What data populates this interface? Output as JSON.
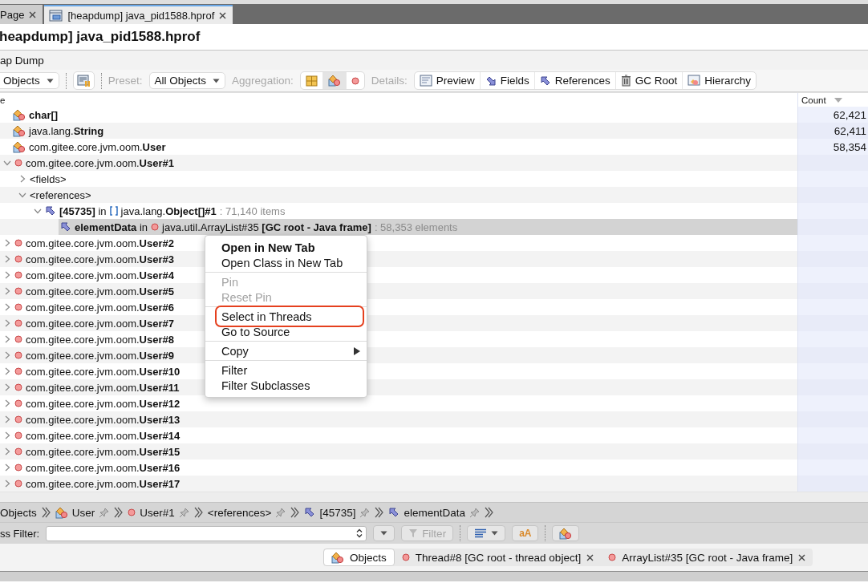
{
  "tabs": [
    {
      "label": "Page",
      "selected": false
    },
    {
      "label": "[heapdump] java_pid1588.hprof",
      "selected": true
    }
  ],
  "title": "heapdump] java_pid1588.hprof",
  "view_title": "ap Dump",
  "toolbar": {
    "view_dropdown": "Objects",
    "preset_label": "Preset:",
    "preset": "All Objects",
    "aggregation_label": "Aggregation:",
    "aggregation": [
      {
        "selected": false
      },
      {
        "selected": true
      },
      {
        "selected": false
      }
    ],
    "details_label": "Details:",
    "details": [
      {
        "label": "Preview"
      },
      {
        "label": "Fields"
      },
      {
        "label": "References"
      },
      {
        "label": "GC Root"
      },
      {
        "label": "Hierarchy"
      }
    ]
  },
  "table": {
    "columns": [
      {
        "label": "e"
      },
      {
        "label": "Count"
      }
    ],
    "rows": [
      {
        "kind": "class",
        "label": "char[]",
        "bold": true,
        "count": "62,421",
        "selected": false
      },
      {
        "kind": "class",
        "label": "java.lang.**String**",
        "bold": false,
        "count": "62,411",
        "selected": false
      },
      {
        "kind": "class",
        "label": "com.gitee.core.jvm.oom.**User**",
        "bold": false,
        "count": "58,354",
        "selected": false,
        "children": [
          {
            "kind": "instance",
            "label": "com.gitee.core.jvm.oom.**User#1**",
            "expanded": true,
            "selected": false,
            "children": [
              {
                "kind": "folder",
                "label": "<fields>",
                "expanded": false,
                "selected": false
              },
              {
                "kind": "folder",
                "label": "<references>",
                "expanded": true,
                "selected": false,
                "children": [
                  {
                    "kind": "arrayref",
                    "label": "**[45735]** in",
                    "target": "java.lang.**Object[]#1**",
                    "detail": ": 71,140 items",
                    "expanded": true,
                    "selected": false,
                    "children": [
                      {
                        "kind": "objectref",
                        "label": "**elementData** in",
                        "target": "java.util.ArrayList#35 **[GC root - Java frame]**",
                        "detail": ": 58,353 elements",
                        "selected": true
                      }
                    ]
                  }
                ]
              }
            ]
          },
          {
            "kind": "instance",
            "label": "com.gitee.core.jvm.oom.**User#2**",
            "expanded": false,
            "selected": false
          },
          {
            "kind": "instance",
            "label": "com.gitee.core.jvm.oom.**User#3**",
            "expanded": false,
            "selected": false
          },
          {
            "kind": "instance",
            "label": "com.gitee.core.jvm.oom.**User#4**",
            "expanded": false,
            "selected": false
          },
          {
            "kind": "instance",
            "label": "com.gitee.core.jvm.oom.**User#5**",
            "expanded": false,
            "selected": false
          },
          {
            "kind": "instance",
            "label": "com.gitee.core.jvm.oom.**User#6**",
            "expanded": false,
            "selected": false
          },
          {
            "kind": "instance",
            "label": "com.gitee.core.jvm.oom.**User#7**",
            "expanded": false,
            "selected": false
          },
          {
            "kind": "instance",
            "label": "com.gitee.core.jvm.oom.**User#8**",
            "expanded": false,
            "selected": false
          },
          {
            "kind": "instance",
            "label": "com.gitee.core.jvm.oom.**User#9**",
            "expanded": false,
            "selected": false
          },
          {
            "kind": "instance",
            "label": "com.gitee.core.jvm.oom.**User#10**",
            "expanded": false,
            "selected": false
          },
          {
            "kind": "instance",
            "label": "com.gitee.core.jvm.oom.**User#11**",
            "expanded": false,
            "selected": false
          },
          {
            "kind": "instance",
            "label": "com.gitee.core.jvm.oom.**User#12**",
            "expanded": false,
            "selected": false
          },
          {
            "kind": "instance",
            "label": "com.gitee.core.jvm.oom.**User#13**",
            "expanded": false,
            "selected": false
          },
          {
            "kind": "instance",
            "label": "com.gitee.core.jvm.oom.**User#14**",
            "expanded": false,
            "selected": false
          },
          {
            "kind": "instance",
            "label": "com.gitee.core.jvm.oom.**User#15**",
            "expanded": false,
            "selected": false
          },
          {
            "kind": "instance",
            "label": "com.gitee.core.jvm.oom.**User#16**",
            "expanded": false,
            "selected": false
          },
          {
            "kind": "instance",
            "label": "com.gitee.core.jvm.oom.**User#17**",
            "expanded": false,
            "selected": false
          }
        ]
      }
    ]
  },
  "context_menu": {
    "groups": [
      [
        {
          "label": "Open in New Tab",
          "default": true,
          "disabled": false,
          "submenu": false,
          "highlighted": false
        },
        {
          "label": "Open Class in New Tab",
          "default": false,
          "disabled": false,
          "submenu": false,
          "highlighted": false
        }
      ],
      [
        {
          "label": "Pin",
          "default": false,
          "disabled": true,
          "submenu": false,
          "highlighted": false
        },
        {
          "label": "Reset Pin",
          "default": false,
          "disabled": true,
          "submenu": false,
          "highlighted": false
        }
      ],
      [
        {
          "label": "Select in Threads",
          "default": false,
          "disabled": false,
          "submenu": false,
          "highlighted": true
        },
        {
          "label": "Go to Source",
          "default": false,
          "disabled": false,
          "submenu": false,
          "highlighted": false
        }
      ],
      [
        {
          "label": "Copy",
          "default": false,
          "disabled": false,
          "submenu": true,
          "highlighted": false
        }
      ],
      [
        {
          "label": "Filter",
          "default": false,
          "disabled": false,
          "submenu": false,
          "highlighted": false
        },
        {
          "label": "Filter Subclasses",
          "default": false,
          "disabled": false,
          "submenu": false,
          "highlighted": false
        }
      ]
    ]
  },
  "breadcrumb": [
    {
      "kind": "root",
      "label": "Objects",
      "pin": false
    },
    {
      "kind": "class",
      "label": "User",
      "pin": true
    },
    {
      "kind": "instance",
      "label": "User#1",
      "pin": true
    },
    {
      "kind": "folder",
      "label": "<references>",
      "pin": true
    },
    {
      "kind": "reference",
      "label": "[45735]",
      "pin": true
    },
    {
      "kind": "reference",
      "label": "elementData",
      "pin": true
    }
  ],
  "filter_bar": {
    "label": "ss Filter:",
    "filter_button": "Filter",
    "filter_disabled": true,
    "case_button": "aA"
  },
  "bottom_tabs": [
    {
      "kind": "class",
      "label": "Objects",
      "selected": true,
      "closable": false
    },
    {
      "kind": "instance",
      "label": "Thread#8 [GC root - thread object]",
      "selected": false,
      "closable": true
    },
    {
      "kind": "instance",
      "label": "ArrayList#35 [GC root - Java frame]",
      "selected": false,
      "closable": true
    }
  ]
}
